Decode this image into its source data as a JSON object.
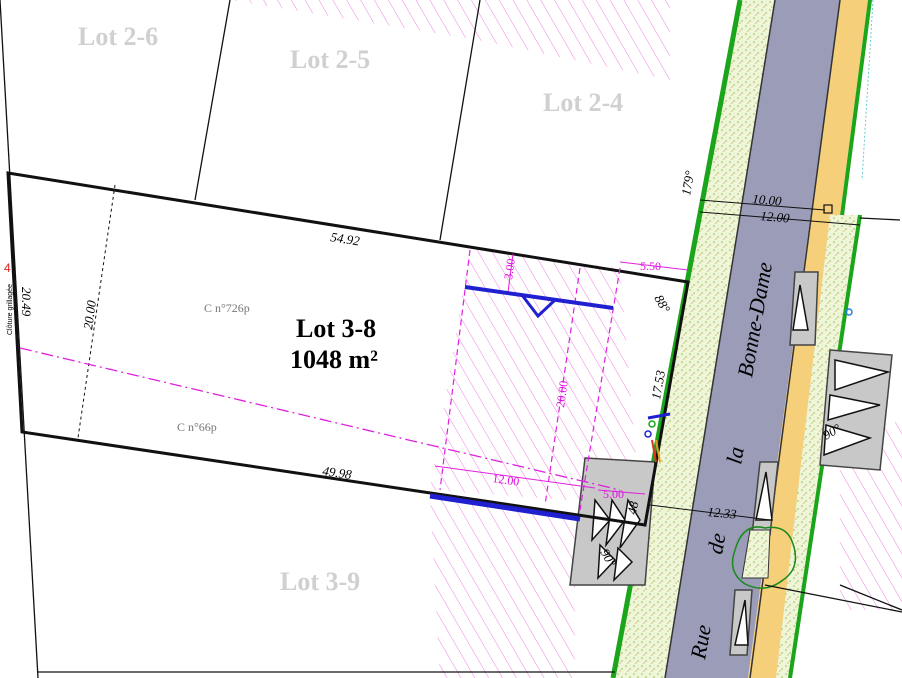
{
  "lots": {
    "lot_2_6": "Lot 2-6",
    "lot_2_5": "Lot 2-5",
    "lot_2_4": "Lot 2-4",
    "lot_3_9": "Lot 3-9",
    "lot_3_8_name": "Lot 3-8",
    "lot_3_8_area": "1048 m²"
  },
  "cadastre": {
    "parcel_1": "C n°726p",
    "parcel_2": "C n°66p"
  },
  "dimensions": {
    "top_edge": "54.92",
    "bottom_edge": "49.98",
    "left_edge": "20.49",
    "width_inner": "20.00",
    "front_edge": "17.53",
    "setback_top": "5.50",
    "setback_bottom": "5.00",
    "build_depth": "12.00",
    "build_width": "20.00",
    "build_offset": "3.00",
    "road_width_1": "10.00",
    "road_width_2": "12.00",
    "road_width_3": "12.33"
  },
  "angles": {
    "a179": "179°",
    "a88": "88°",
    "a90_left": "90°",
    "a90_right": "90°",
    "a48": "48"
  },
  "notes": {
    "left_note": "Clôture grillagée"
  },
  "street": {
    "word_1": "Rue",
    "word_2": "de",
    "word_3": "la",
    "word_4": "Bonne-Dame"
  },
  "colors": {
    "road": "#9a9cb8",
    "verge": "#e0ecc0",
    "cycle": "#f5cf7a",
    "green_line": "#1aa51a",
    "magenta": "#e020e0",
    "blue": "#2020d0"
  }
}
